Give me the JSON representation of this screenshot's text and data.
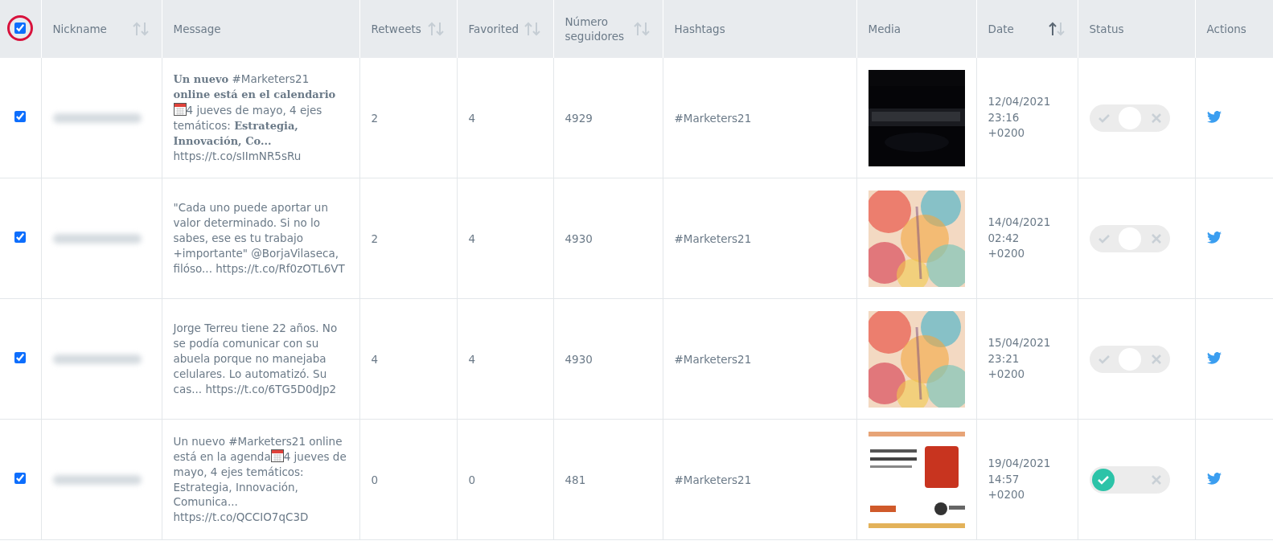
{
  "table": {
    "select_all": {
      "checked": true,
      "highlighted": true
    },
    "columns": [
      {
        "label": "Nickname",
        "sortable": true,
        "sorted": false
      },
      {
        "label": "Message"
      },
      {
        "label": "Retweets",
        "sortable": true,
        "sorted": false
      },
      {
        "label": "Favorited",
        "sortable": true,
        "sorted": false
      },
      {
        "label": "Número seguidores",
        "sortable": true,
        "sorted": false
      },
      {
        "label": "Hashtags"
      },
      {
        "label": "Media"
      },
      {
        "label": "Date",
        "sortable": true,
        "sorted": true
      },
      {
        "label": "Status"
      },
      {
        "label": "Actions"
      }
    ],
    "rows": [
      {
        "checked": true,
        "message": [
          {
            "kind": "text",
            "text": "**Un nuevo** #Marketers21 **online está en el calendario** "
          },
          {
            "kind": "calendar"
          },
          {
            "kind": "text",
            "text": "4 jueves de mayo, 4 ejes temáticos: **Estrategia, Innovación, Co...** https://t.co/sIImNR5sRu"
          }
        ],
        "retweets": "2",
        "favorited": "4",
        "followers": "4929",
        "hashtags": "#Marketers21",
        "media": {
          "kind": "picture"
        },
        "date": [
          "12/04/2021",
          "23:16",
          "+0200"
        ],
        "approved": false
      },
      {
        "checked": true,
        "message": [
          {
            "kind": "text",
            "text": "\"Cada uno puede aportar un valor determinado. Si no lo sabes, ese es tu trabajo +importante\" @BorjaVilaseca, filóso... https://t.co/Rf0zOTL6VT"
          }
        ],
        "retweets": "2",
        "favorited": "4",
        "followers": "4930",
        "hashtags": "#Marketers21",
        "media": {
          "kind": "picture"
        },
        "date": [
          "14/04/2021",
          "02:42",
          "+0200"
        ],
        "approved": false
      },
      {
        "checked": true,
        "message": [
          {
            "kind": "text",
            "text": "Jorge Terreu tiene 22 años. No se podía comunicar con su abuela porque no manejaba celulares. Lo automatizó. Su cas... https://t.co/6TG5D0dJp2"
          }
        ],
        "retweets": "4",
        "favorited": "4",
        "followers": "4930",
        "hashtags": "#Marketers21",
        "media": {
          "kind": "picture"
        },
        "date": [
          "15/04/2021",
          "23:21",
          "+0200"
        ],
        "approved": false
      },
      {
        "checked": true,
        "message": [
          {
            "kind": "text",
            "text": "Un nuevo #Marketers21 online está en la agenda"
          },
          {
            "kind": "calendar"
          },
          {
            "kind": "text",
            "text": "4 jueves de mayo, 4 ejes temáticos: Estrategia, Innovación, Comunica... https://t.co/QCCIO7qC3D"
          }
        ],
        "retweets": "0",
        "favorited": "0",
        "followers": "481",
        "hashtags": "#Marketers21",
        "media": {
          "kind": "picture"
        },
        "date": [
          "19/04/2021",
          "14:57",
          "+0200"
        ],
        "approved": true
      }
    ]
  }
}
